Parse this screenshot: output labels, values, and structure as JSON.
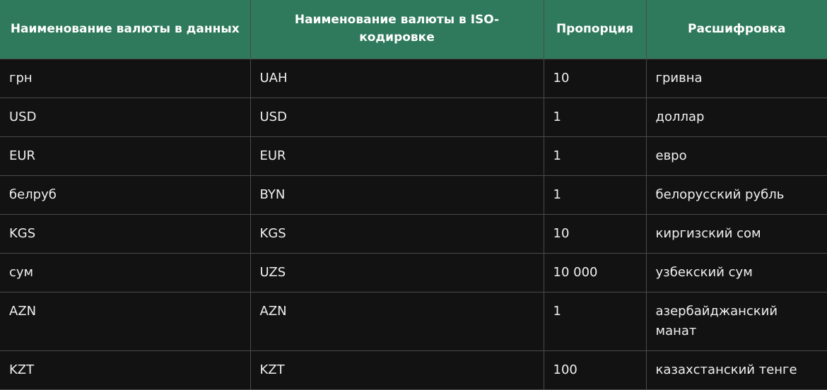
{
  "table": {
    "headers": [
      "Наименование валюты в данных",
      "Наименование валюты в ISO-кодировке",
      "Пропорция",
      "Расшифровка"
    ],
    "rows": [
      [
        "грн",
        "UAH",
        "10",
        "гривна"
      ],
      [
        "USD",
        "USD",
        "1",
        "доллар"
      ],
      [
        "EUR",
        "EUR",
        "1",
        "евро"
      ],
      [
        "белруб",
        "BYN",
        "1",
        "белорусский рубль"
      ],
      [
        "KGS",
        "KGS",
        "10",
        "киргизский сом"
      ],
      [
        "сум",
        "UZS",
        "10 000",
        "узбекский сум"
      ],
      [
        "AZN",
        "AZN",
        "1",
        "азербайджанский манат"
      ],
      [
        "KZT",
        "KZT",
        "100",
        "казахстанский тенге"
      ]
    ]
  }
}
